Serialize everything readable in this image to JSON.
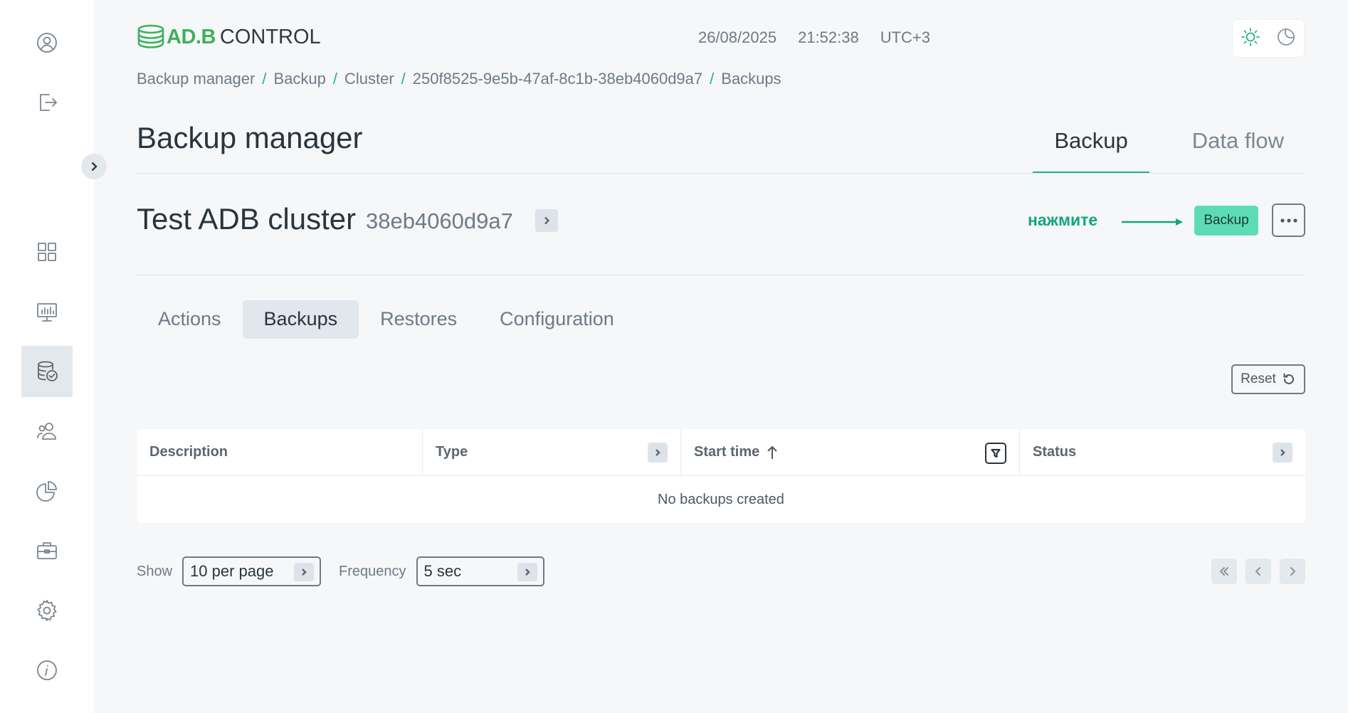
{
  "app": {
    "logo_primary": "AD.B",
    "logo_secondary": "CONTROL",
    "brand_color": "#3fb15b",
    "accent_color": "#1fb48a"
  },
  "header": {
    "date": "26/08/2025",
    "time": "21:52:38",
    "timezone": "UTC+3",
    "theme_icons": [
      "sun-icon",
      "moon-icon"
    ]
  },
  "sidebar": {
    "top_icons": [
      "user-icon",
      "logout-icon"
    ],
    "items": [
      {
        "icon": "dashboard-icon",
        "active": false
      },
      {
        "icon": "monitoring-icon",
        "active": false
      },
      {
        "icon": "database-backup-icon",
        "active": true
      },
      {
        "icon": "users-icon",
        "active": false
      },
      {
        "icon": "pie-chart-icon",
        "active": false
      },
      {
        "icon": "briefcase-icon",
        "active": false
      },
      {
        "icon": "settings-icon",
        "active": false
      },
      {
        "icon": "info-icon",
        "active": false
      }
    ]
  },
  "breadcrumb": [
    "Backup manager",
    "Backup",
    "Cluster",
    "250f8525-9e5b-47af-8c1b-38eb4060d9a7",
    "Backups"
  ],
  "page": {
    "title": "Backup manager",
    "top_tabs": [
      {
        "label": "Backup",
        "active": true
      },
      {
        "label": "Data flow",
        "active": false
      }
    ]
  },
  "cluster": {
    "name": "Test ADB cluster",
    "id_short": "38eb4060d9a7",
    "hint": "нажмите",
    "backup_button": "Backup"
  },
  "sub_tabs": [
    {
      "label": "Actions",
      "active": false
    },
    {
      "label": "Backups",
      "active": true
    },
    {
      "label": "Restores",
      "active": false
    },
    {
      "label": "Configuration",
      "active": false
    }
  ],
  "reset_label": "Reset",
  "table": {
    "columns": [
      {
        "label": "Description",
        "control": "none"
      },
      {
        "label": "Type",
        "control": "expand"
      },
      {
        "label": "Start time",
        "control": "filter",
        "sort": "asc"
      },
      {
        "label": "Status",
        "control": "expand"
      }
    ],
    "empty_message": "No backups created"
  },
  "pager": {
    "show_label": "Show",
    "per_page": "10 per page",
    "frequency_label": "Frequency",
    "frequency": "5 sec"
  }
}
